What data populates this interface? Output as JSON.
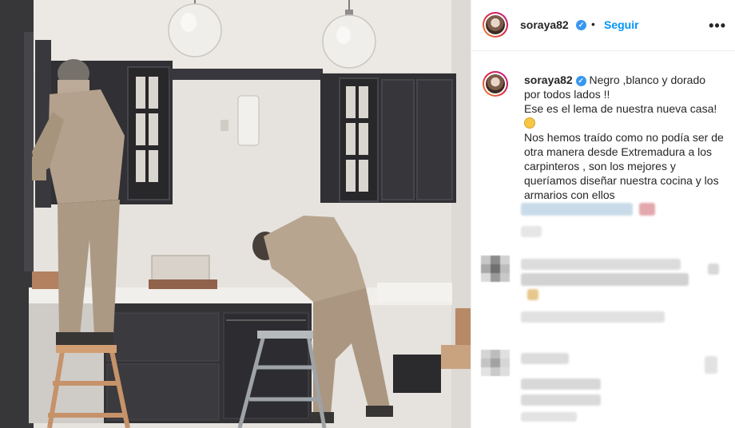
{
  "post": {
    "username": "soraya82",
    "follow_label": "Seguir",
    "separator": "•",
    "more_label": "•••",
    "verified_icon": "✓"
  },
  "caption": {
    "username": "soraya82",
    "line1": "Negro ,blanco y dorado por todos lados !!",
    "line2": "Ese es el lema de nuestra nueva casa!",
    "line3": "Nos hemos traído como no podía ser de otra manera desde Extremadura a los carpinteros , son los mejores y queríamos diseñar nuestra cocina y los armarios con ellos"
  },
  "colors": {
    "accent": "#0095f6",
    "verified": "#3897f0",
    "text": "#262626",
    "border": "#efefef"
  },
  "icons": {
    "verified": "verified-badge-icon",
    "more": "more-options-icon",
    "emoji": "grimacing-face-icon"
  }
}
